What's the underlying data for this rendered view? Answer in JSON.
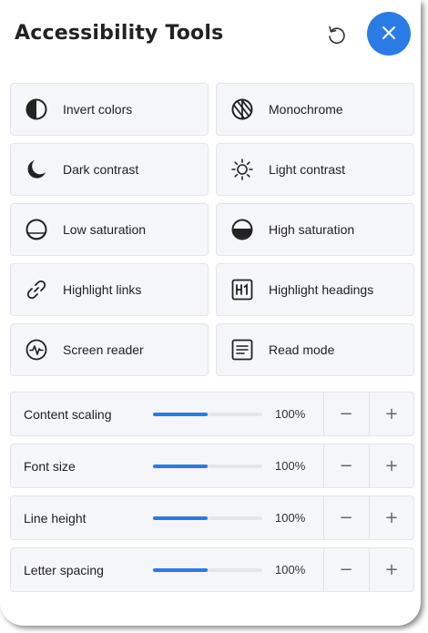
{
  "header": {
    "title": "Accessibility Tools",
    "reset_icon": "reset-icon",
    "close_icon": "close-icon"
  },
  "colors": {
    "accent": "#2b7be6",
    "tile_bg": "#f5f6fa"
  },
  "tools": [
    {
      "label": "Invert colors",
      "icon": "invert-colors-icon"
    },
    {
      "label": "Monochrome",
      "icon": "monochrome-icon"
    },
    {
      "label": "Dark contrast",
      "icon": "moon-icon"
    },
    {
      "label": "Light contrast",
      "icon": "sun-icon"
    },
    {
      "label": "Low saturation",
      "icon": "low-saturation-icon"
    },
    {
      "label": "High saturation",
      "icon": "high-saturation-icon"
    },
    {
      "label": "Highlight links",
      "icon": "link-icon"
    },
    {
      "label": "Highlight headings",
      "icon": "heading-icon"
    },
    {
      "label": "Screen reader",
      "icon": "screen-reader-icon"
    },
    {
      "label": "Read mode",
      "icon": "read-mode-icon"
    }
  ],
  "sliders": [
    {
      "label": "Content scaling",
      "value": "100%",
      "level": 0.5,
      "minus": "−",
      "plus": "+"
    },
    {
      "label": "Font size",
      "value": "100%",
      "level": 0.5,
      "minus": "−",
      "plus": "+"
    },
    {
      "label": "Line height",
      "value": "100%",
      "level": 0.5,
      "minus": "−",
      "plus": "+"
    },
    {
      "label": "Letter spacing",
      "value": "100%",
      "level": 0.5,
      "minus": "−",
      "plus": "+"
    }
  ]
}
